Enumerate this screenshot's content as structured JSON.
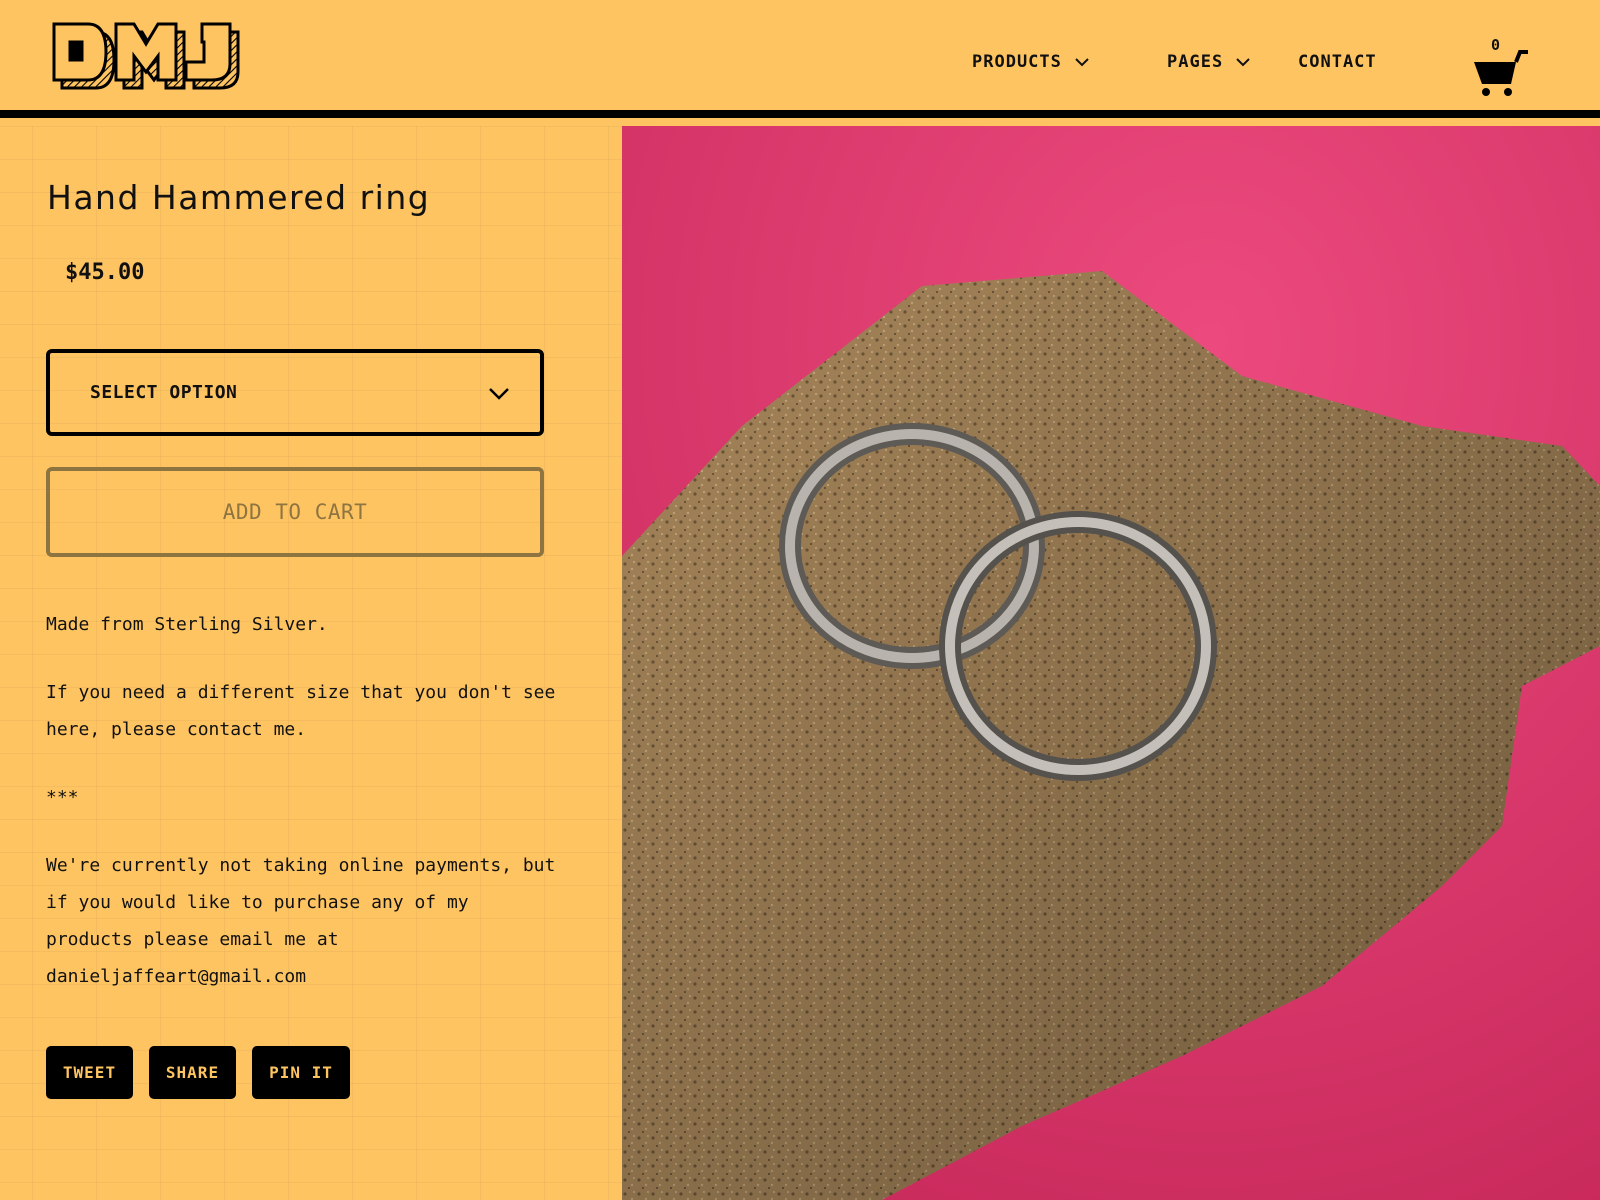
{
  "header": {
    "logo_text": "DMJ",
    "nav": [
      {
        "label": "PRODUCTS"
      },
      {
        "label": "PAGES"
      },
      {
        "label": "CONTACT"
      }
    ],
    "cart_count": "0"
  },
  "product": {
    "title": "Hand Hammered ring",
    "price": "$45.00",
    "select_label": "SELECT OPTION",
    "add_to_cart": "ADD TO CART",
    "description": [
      "Made from Sterling Silver.",
      "If you need a different size that you don't see here, please contact me.",
      "***",
      "We're currently not taking online payments, but if you would like to purchase any of my products please email me at danieljaffeart@gmail.com"
    ]
  },
  "share": {
    "tweet": "TWEET",
    "share": "SHARE",
    "pin": "PIN IT"
  },
  "colors": {
    "background": "#ffc462",
    "border": "#000000",
    "disabled": "#8e7440",
    "photo_backdrop": "#e23a6e"
  }
}
